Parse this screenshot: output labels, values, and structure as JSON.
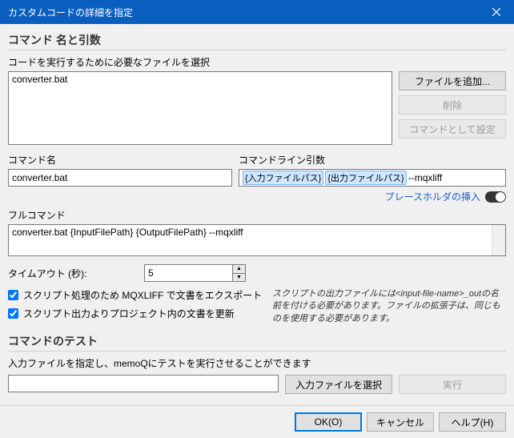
{
  "title": "カスタムコードの詳細を指定",
  "section1": {
    "heading": "コマンド 名と引数",
    "filelist_label": "コードを実行するために必要なファイルを選択",
    "filelist_item": "converter.bat",
    "btn_add": "ファイルを追加...",
    "btn_delete": "削除",
    "btn_setcmd": "コマンドとして設定"
  },
  "cmdname": {
    "label": "コマンド名",
    "value": "converter.bat"
  },
  "cmdargs": {
    "label": "コマンドライン引数",
    "ph1": "{入力ファイルパス}",
    "ph2": "{出力ファイルパス}",
    "rest": " --mqxliff"
  },
  "placeholder_link": "プレースホルダの挿入",
  "fullcmd": {
    "label": "フルコマンド",
    "value": "converter.bat {InputFilePath} {OutputFilePath} --mqxliff"
  },
  "timeout": {
    "label": "タイムアウト (秒):",
    "value": "5"
  },
  "check1": "スクリプト処理のため MQXLIFF で文書をエクスポート",
  "check2": "スクリプト出力よりプロジェクト内の文書を更新",
  "note": "スクリプトの出力ファイルには<input-file-name>_outの名前を付ける必要があります。ファイルの拡張子は、同じものを使用する必要があります。",
  "section2": {
    "heading": "コマンドのテスト",
    "desc": "入力ファイルを指定し、memoQにテストを実行させることができます",
    "btn_select": "入力ファイルを選択",
    "btn_run": "実行"
  },
  "footer": {
    "ok": "OK(O)",
    "cancel": "キャンセル",
    "help": "ヘルプ(H)"
  }
}
